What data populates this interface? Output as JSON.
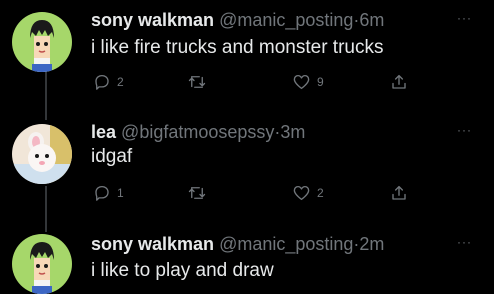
{
  "tweets": [
    {
      "name": "sony walkman",
      "handle": "@manic_posting",
      "separator": "·",
      "time": "6m",
      "more": "···",
      "text": "i like fire trucks and monster trucks",
      "avatar": "anime-boy-avatar",
      "actions": {
        "reply_count": "2",
        "retweet_count": "",
        "like_count": "9"
      }
    },
    {
      "name": "lea",
      "handle": "@bigfatmoosepssy",
      "separator": "·",
      "time": "3m",
      "more": "···",
      "text": "idgaf",
      "avatar": "plush-toy-avatar",
      "actions": {
        "reply_count": "1",
        "retweet_count": "",
        "like_count": "2"
      }
    },
    {
      "name": "sony walkman",
      "handle": "@manic_posting",
      "separator": "·",
      "time": "2m",
      "more": "···",
      "text": "i like to play and draw",
      "avatar": "anime-boy-avatar"
    }
  ],
  "colors": {
    "background": "#000000",
    "text_primary": "#e7e9ea",
    "text_secondary": "#71767b",
    "thread_line": "#333639",
    "avatar_green": "#a6d76a"
  }
}
